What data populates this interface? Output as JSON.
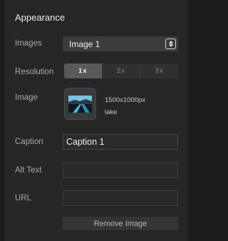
{
  "section": {
    "title": "Appearance"
  },
  "labels": {
    "images": "Images",
    "resolution": "Resolution",
    "image": "Image",
    "caption": "Caption",
    "alt_text": "Alt Text",
    "url": "URL"
  },
  "images_select": {
    "value": "Image 1"
  },
  "resolution": {
    "options": [
      "1x",
      "2x",
      "3x"
    ],
    "selected": "1x"
  },
  "image_info": {
    "dimensions": "1500x1000px",
    "name": "lake",
    "thumbnail_icon": "lake-photo-icon"
  },
  "caption": {
    "value": "Caption 1"
  },
  "alt_text": {
    "value": ""
  },
  "url": {
    "value": ""
  },
  "remove_button": {
    "label": "Remove Image"
  },
  "colors": {
    "background": "#262626",
    "active_segment": "#595959",
    "select_bg": "#3c3c3c"
  }
}
